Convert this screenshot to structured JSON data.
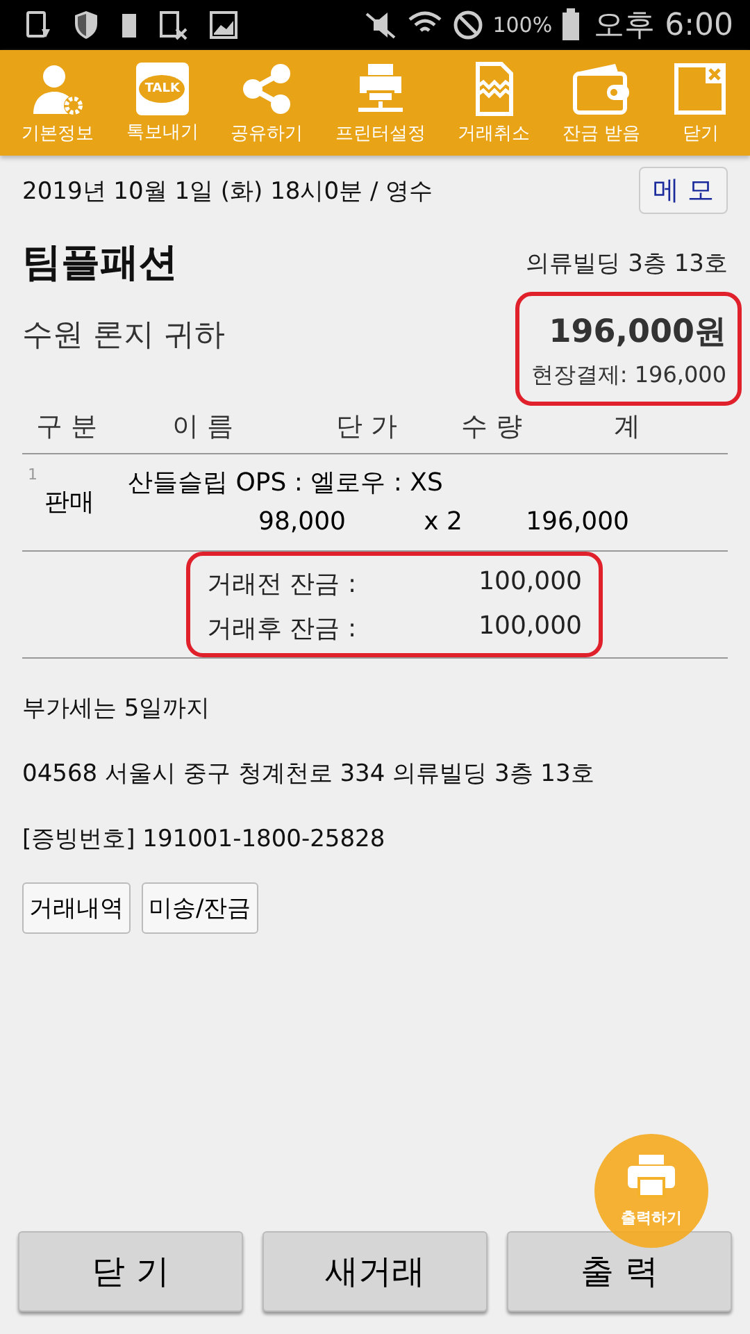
{
  "status_bar": {
    "battery": "100%",
    "time": "오후 6:00"
  },
  "toolbar": [
    {
      "label": "기본정보",
      "kind": "person"
    },
    {
      "label": "톡보내기",
      "kind": "talk",
      "badge": "TALK"
    },
    {
      "label": "공유하기",
      "kind": "share"
    },
    {
      "label": "프린터설정",
      "kind": "printer"
    },
    {
      "label": "거래취소",
      "kind": "torn"
    },
    {
      "label": "잔금 받음",
      "kind": "wallet"
    },
    {
      "label": "닫기",
      "kind": "close"
    }
  ],
  "header": {
    "datetime": "2019년 10월 1일 (화) 18시0분 / 영수",
    "memo_button": "메 모"
  },
  "shop": {
    "name": "팀플패션",
    "address": "의류빌딩 3층 13호"
  },
  "customer": "수원 론지 귀하",
  "total": {
    "amount": "196,000원",
    "payment": "현장결제: 196,000",
    "highlighted": true
  },
  "table": {
    "columns": [
      "구 분",
      "이 름",
      "단 가",
      "수 량",
      "계"
    ],
    "rows": [
      {
        "index": "1",
        "type": "판매",
        "name": "산들슬립 OPS : 엘로우 : XS",
        "price": "98,000",
        "qty": "x 2",
        "amount": "196,000"
      }
    ]
  },
  "balance": {
    "highlighted": true,
    "rows": [
      {
        "label": "거래전 잔금 :",
        "value": "100,000"
      },
      {
        "label": "거래후 잔금 :",
        "value": "100,000"
      }
    ]
  },
  "notes": [
    "부가세는 5일까지",
    "04568 서울시 중구 청계천로 334 의류빌딩 3층 13호",
    "[증빙번호] 191001-1800-25828"
  ],
  "link_buttons": [
    "거래내역",
    "미송/잔금"
  ],
  "fab": {
    "label": "출력하기"
  },
  "bottom_buttons": [
    "닫 기",
    "새거래",
    "출 력"
  ]
}
